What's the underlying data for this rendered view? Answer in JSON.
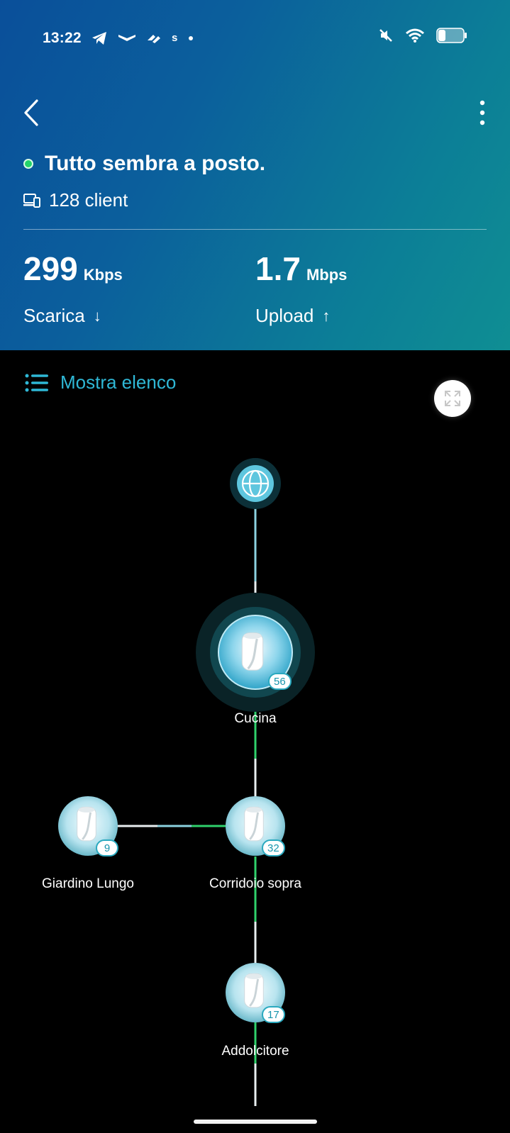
{
  "status_bar": {
    "time": "13:22",
    "left_icons": [
      "telegram-icon",
      "app-icon-1",
      "app-icon-2",
      "app-icon-s",
      "dot-icon"
    ],
    "right_icons": [
      "mute-icon",
      "wifi-icon",
      "battery-icon"
    ]
  },
  "header": {
    "status_text": "Tutto sembra a posto.",
    "status_color": "#22d36a",
    "clients": "128 client",
    "download": {
      "value": "299",
      "unit": "Kbps",
      "label": "Scarica",
      "arrow": "↓"
    },
    "upload": {
      "value": "1.7",
      "unit": "Mbps",
      "label": "Upload",
      "arrow": "↑"
    }
  },
  "list_toggle": {
    "label": "Mostra elenco"
  },
  "nodes": {
    "cucina": {
      "name": "Cucina",
      "clients": "56"
    },
    "giardino": {
      "name": "Giardino Lungo",
      "clients": "9"
    },
    "corridoio": {
      "name": "Corridoio sopra",
      "clients": "32"
    },
    "addolcitore": {
      "name": "Addolcitore",
      "clients": "17"
    }
  },
  "colors": {
    "accent": "#2fb8d6",
    "link_good": "#2fd16b",
    "link_neutral": "#e8eef0"
  }
}
